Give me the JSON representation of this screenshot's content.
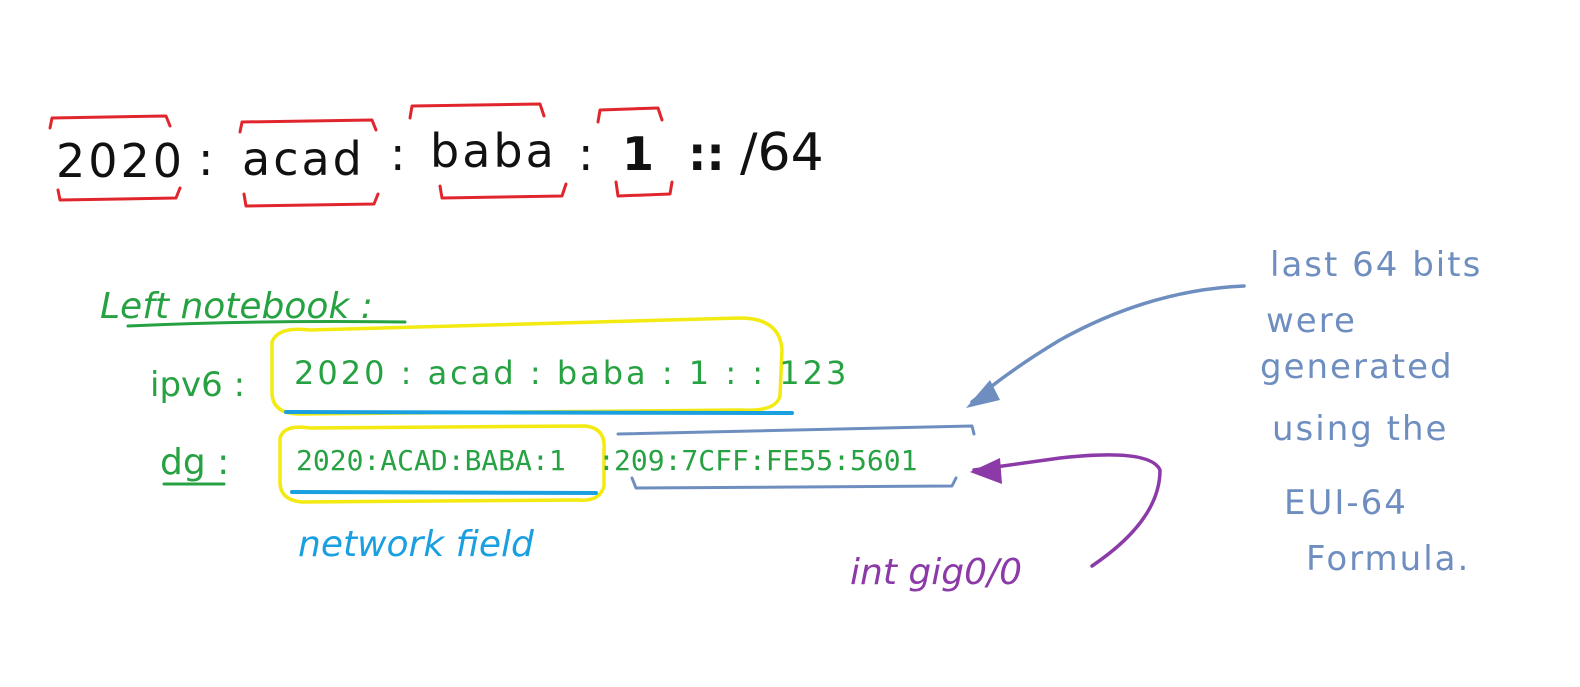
{
  "colors": {
    "ink": "#111111",
    "bracket": "#e0262c",
    "green": "#27a243",
    "yellow": "#f2ea10",
    "blue_underline": "#1aa0e0",
    "slate": "#6f8ec0",
    "purple": "#8b3aa8"
  },
  "top_address": {
    "segments": [
      {
        "text": "2020",
        "bracketed": true
      },
      {
        "text": ":",
        "bracketed": false
      },
      {
        "text": "acad",
        "bracketed": true
      },
      {
        "text": ":",
        "bracketed": false
      },
      {
        "text": "baba",
        "bracketed": true
      },
      {
        "text": ":",
        "bracketed": false
      },
      {
        "text": "1",
        "bracketed": true
      },
      {
        "text": "::",
        "bracketed": false
      }
    ],
    "prefix": "/64"
  },
  "left_notebook": {
    "heading": "Left notebook :",
    "ipv6_label": "ipv6 :",
    "ipv6_value": "2020 : acad : baba : 1 : : 123",
    "dg_label": "dg :",
    "dg_network": "2020:ACAD:BABA:1",
    "dg_separator": ":",
    "dg_host": "209:7CFF:FE55:5601",
    "network_field_note": "network field"
  },
  "interface_note": "int gig0/0",
  "eui_note": {
    "lines": [
      "last 64 bits",
      "were",
      "generated",
      "using the",
      "EUI-64",
      "Formula."
    ]
  }
}
